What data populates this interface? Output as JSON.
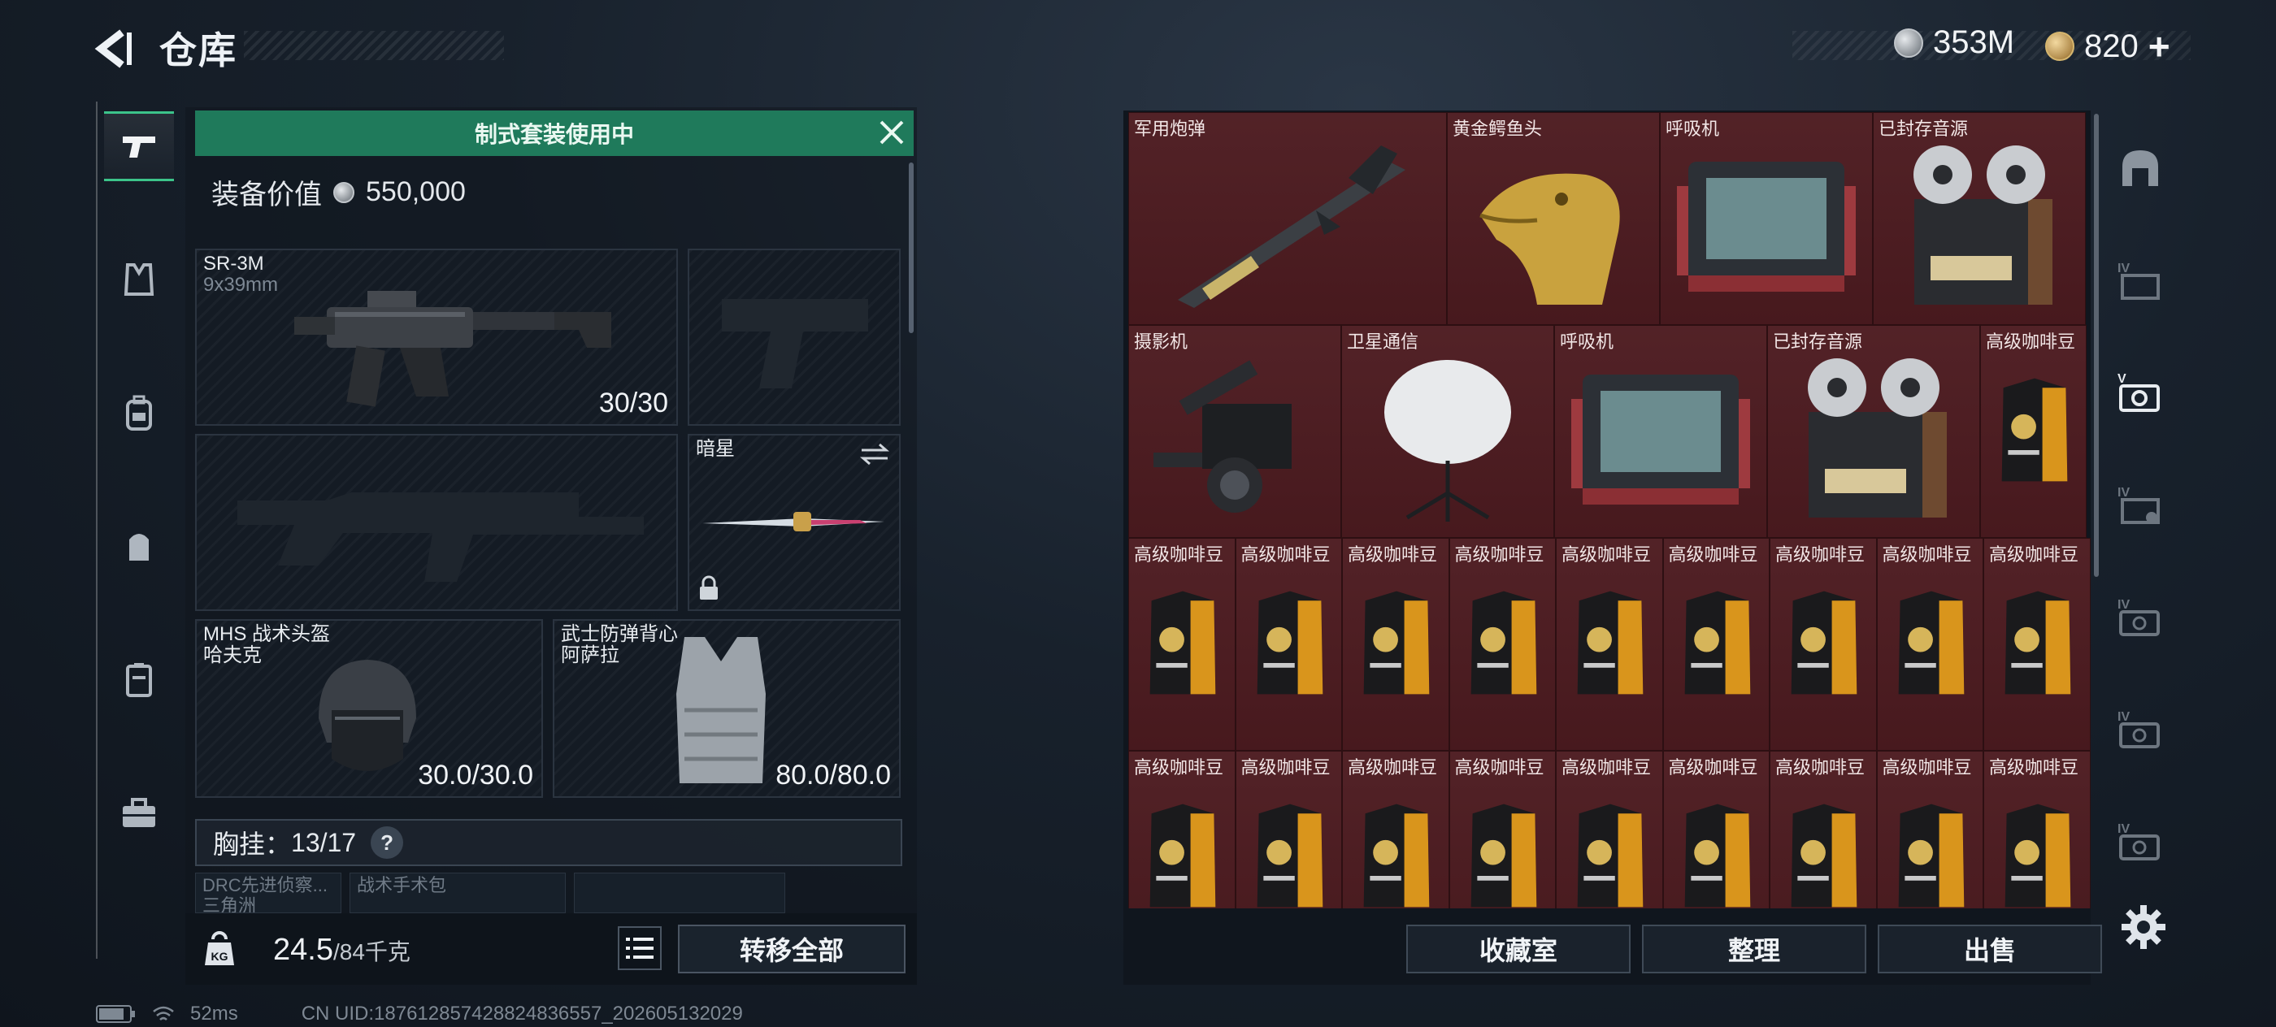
{
  "header": {
    "title": "仓库",
    "currency_silver": "353M",
    "currency_gold": "820",
    "currency_gold_plus": "+"
  },
  "loadout": {
    "kit_banner": "制式套装使用中",
    "value_label": "装备价值",
    "value": "550,000",
    "primary": {
      "name": "SR-3M",
      "caliber": "9x39mm",
      "ammo": "30/30"
    },
    "melee": {
      "name": "暗星"
    },
    "helmet": {
      "name": "MHS 战术头盔",
      "sub": "哈夫克",
      "durability": "30.0/30.0"
    },
    "armor": {
      "name": "武士防弹背心",
      "sub": "阿萨拉",
      "durability": "80.0/80.0"
    },
    "chest_rig": {
      "label": "胸挂：",
      "count": "13/17",
      "help": "?"
    },
    "mini_slots": [
      {
        "line1": "DRC先进侦察...",
        "line2": "三角洲"
      },
      {
        "line1": "战术手术包",
        "line2": ""
      }
    ],
    "weight_value": "24.5",
    "weight_cap": "/84千克",
    "transfer_all": "转移全部"
  },
  "storage": {
    "rows": [
      [
        "军用炮弹",
        "黄金鳄鱼头",
        "呼吸机",
        "已封存音源"
      ],
      [
        "摄影机",
        "卫星通信",
        "呼吸机",
        "已封存音源",
        "高级咖啡豆"
      ],
      [
        "高级咖啡豆",
        "高级咖啡豆",
        "高级咖啡豆",
        "高级咖啡豆",
        "高级咖啡豆",
        "高级咖啡豆",
        "高级咖啡豆",
        "高级咖啡豆",
        "高级咖啡豆"
      ],
      [
        "高级咖啡豆",
        "高级咖啡豆",
        "高级咖啡豆",
        "高级咖啡豆",
        "高级咖啡豆",
        "高级咖啡豆",
        "高级咖啡豆",
        "高级咖啡豆",
        "高级咖啡豆"
      ]
    ],
    "buttons": {
      "collection": "收藏室",
      "organize": "整理",
      "sell": "出售"
    }
  },
  "status_bar": {
    "ping": "52ms",
    "uid": "CN UID:18761285742882483​6557_202605132029"
  },
  "colors": {
    "accent_green": "#1f7a5b",
    "item_red": "#4d1b20",
    "panel_bg": "#10161e"
  },
  "icons": {
    "left_nav": [
      "pistol-icon",
      "vest-icon",
      "backpack-icon",
      "rig-icon",
      "case-icon",
      "toolbox-icon"
    ],
    "right_nav": [
      "vault-icon",
      "storage-iv-icon",
      "storage-v-icon",
      "storage-iv-b-icon",
      "storage-iv-c-icon",
      "storage-iv-d-icon",
      "storage-iv-e-icon"
    ]
  }
}
